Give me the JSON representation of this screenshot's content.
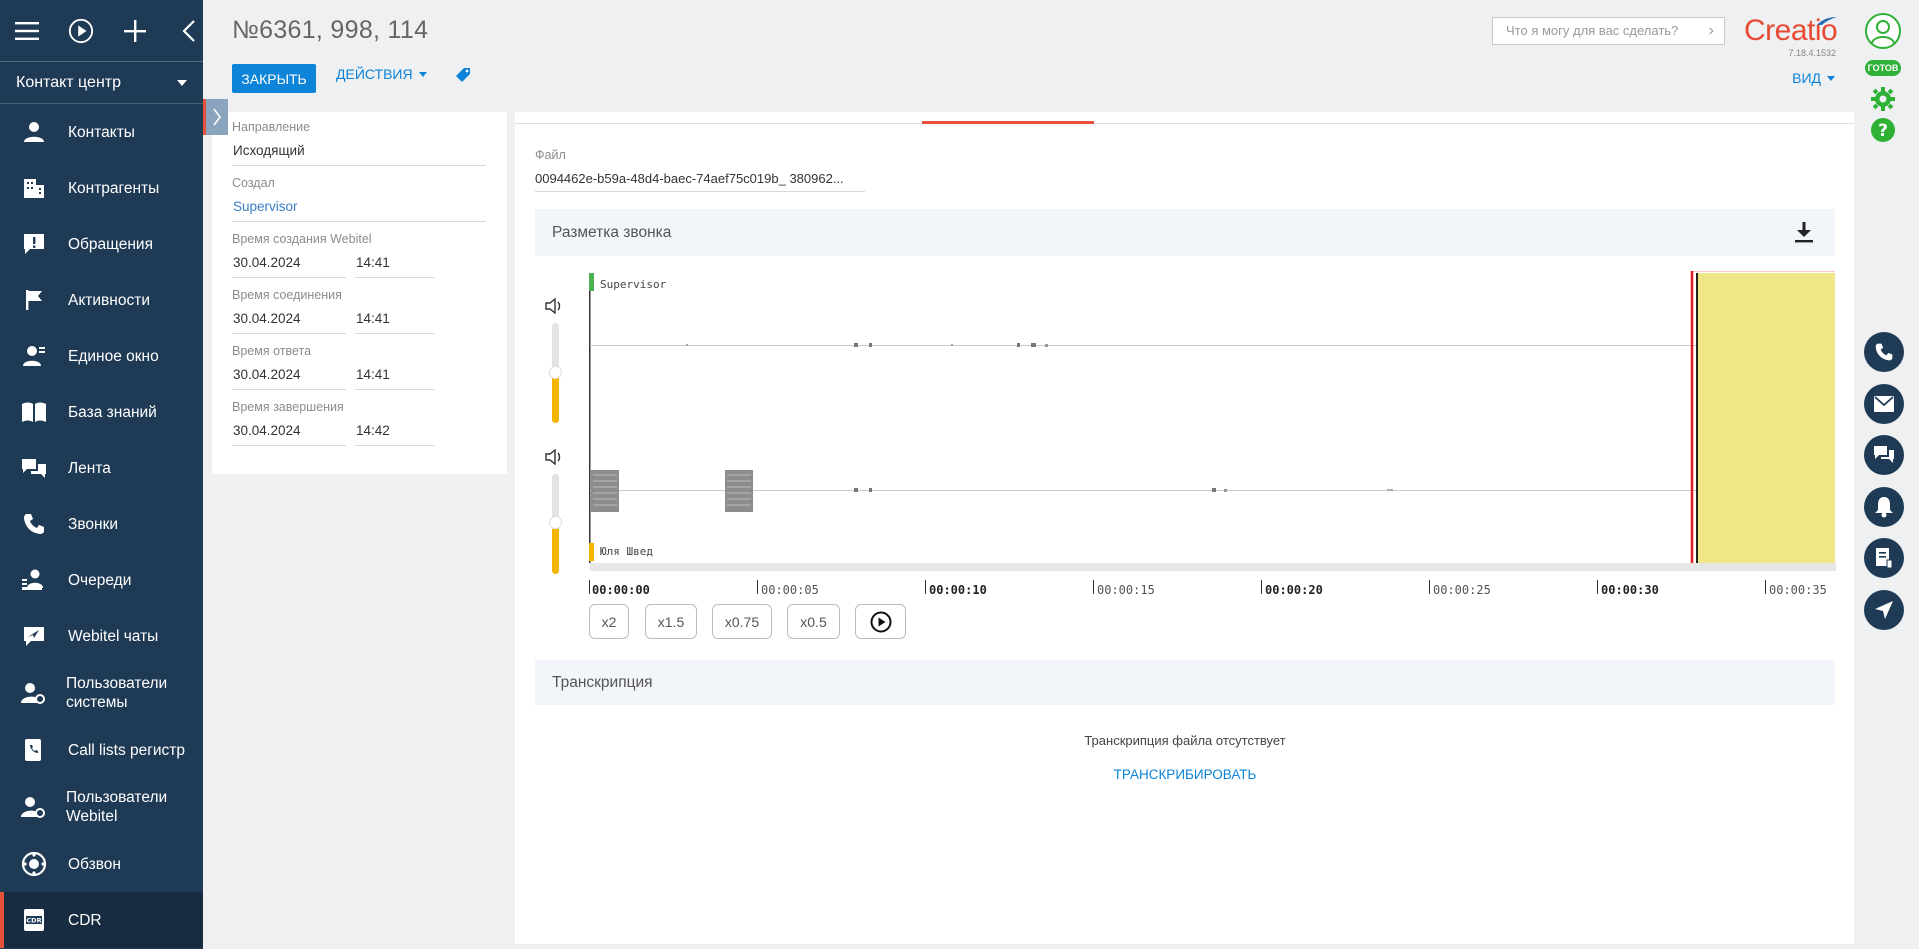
{
  "nav": {
    "section_label": "Контакт центр",
    "items": [
      {
        "label": "Контакты",
        "icon": "person-icon"
      },
      {
        "label": "Контрагенты",
        "icon": "building-icon"
      },
      {
        "label": "Обращения",
        "icon": "exclamation-icon"
      },
      {
        "label": "Активности",
        "icon": "flag-icon"
      },
      {
        "label": "Единое окно",
        "icon": "person-window-icon"
      },
      {
        "label": "База знаний",
        "icon": "book-icon"
      },
      {
        "label": "Лента",
        "icon": "feed-icon"
      },
      {
        "label": "Звонки",
        "icon": "phone-icon"
      },
      {
        "label": "Очереди",
        "icon": "queue-icon"
      },
      {
        "label": "Webitel чаты",
        "icon": "chat-send-icon"
      },
      {
        "label": "Пользователи системы",
        "icon": "user-gear-icon"
      },
      {
        "label": "Call lists регистр",
        "icon": "phone-list-icon"
      },
      {
        "label": "Пользователи Webitel",
        "icon": "user-gear-icon"
      },
      {
        "label": "Обзвон",
        "icon": "dialer-icon"
      },
      {
        "label": "CDR",
        "icon": "cdr-icon"
      }
    ]
  },
  "header": {
    "title": "№6361, 998, 114",
    "close_label": "ЗАКРЫТЬ",
    "actions_label": "ДЕЙСТВИЯ",
    "search_placeholder": "Что я могу для вас сделать?",
    "logo_text": "Creatio",
    "version": "7.18.4.1532",
    "view_label": "ВИД"
  },
  "status": {
    "ready_label": "ГОТОВ"
  },
  "details": {
    "direction_label": "Направление",
    "direction_value": "Исходящий",
    "created_by_label": "Создал",
    "created_by_value": "Supervisor",
    "created_webitel_label": "Время создания Webitel",
    "created_webitel_date": "30.04.2024",
    "created_webitel_time": "14:41",
    "connect_label": "Время соединения",
    "connect_date": "30.04.2024",
    "connect_time": "14:41",
    "answer_label": "Время ответа",
    "answer_date": "30.04.2024",
    "answer_time": "14:41",
    "end_label": "Время завершения",
    "end_date": "30.04.2024",
    "end_time": "14:42"
  },
  "file": {
    "label": "Файл",
    "value": "0094462e-b59a-48d4-baec-74aef75c019b_ 380962..."
  },
  "call_markup": {
    "title": "Разметка звонка",
    "speaker_top": "Supervisor",
    "speaker_bottom": "Юля Швед",
    "timeline": [
      "00:00:00",
      "00:00:05",
      "00:00:10",
      "00:00:15",
      "00:00:20",
      "00:00:25",
      "00:00:30",
      "00:00:35"
    ],
    "speeds": [
      "x2",
      "x1.5",
      "x0.75",
      "x0.5"
    ]
  },
  "transcription": {
    "title": "Транскрипция",
    "empty_text": "Транскрипция файла отсутствует",
    "action_label": "ТРАНСКРИБИРОВАТЬ"
  },
  "colors": {
    "nav_bg": "#1f3a54",
    "accent_blue": "#0d84d8",
    "accent_red": "#e6513b",
    "highlight_yellow": "#efe787",
    "volume_yellow": "#f4b400",
    "status_green": "#2eb135"
  }
}
